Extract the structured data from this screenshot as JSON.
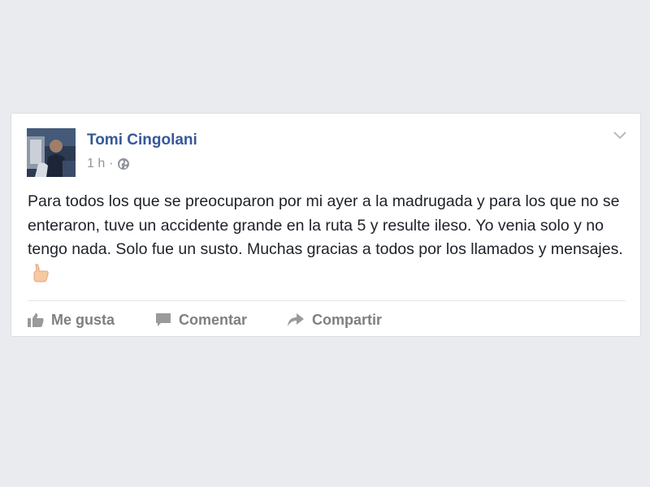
{
  "post": {
    "author": "Tomi Cingolani",
    "timestamp": "1 h",
    "separator": "·",
    "privacy_icon": "globe-icon",
    "text": "Para todos los que se preocuparon por mi ayer a la madrugada y para los que no se enteraron, tuve un accidente grande en la ruta 5 y resulte ileso. Yo venia solo y no tengo nada. Solo fue un susto. Muchas gracias a todos por los llamados y mensajes.",
    "emoji": "thumbs-up-emoji"
  },
  "actions": {
    "like_label": "Me gusta",
    "comment_label": "Comentar",
    "share_label": "Compartir"
  },
  "colors": {
    "background": "#e9ebee",
    "card": "#ffffff",
    "author_link": "#365899",
    "meta_text": "#90949c",
    "body_text": "#1d2129",
    "action_text": "#7f7f7f"
  }
}
